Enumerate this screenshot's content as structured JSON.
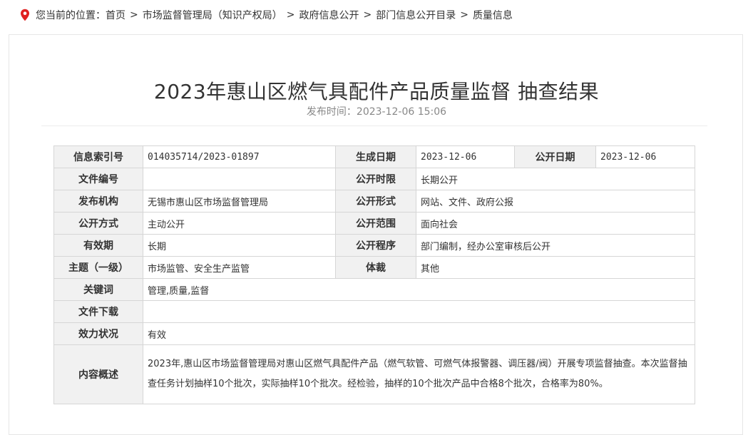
{
  "breadcrumb": {
    "prefix": "您当前的位置：",
    "items": [
      "首页",
      "市场监督管理局（知识产权局）",
      "政府信息公开",
      "部门信息公开目录",
      "质量信息"
    ],
    "separator": ">"
  },
  "article": {
    "title": "2023年惠山区燃气具配件产品质量监督 抽查结果",
    "publish_label": "发布时间：",
    "publish_time": "2023-12-06 15:06"
  },
  "meta": {
    "index_no": {
      "label": "信息索引号",
      "value": "014035714/2023-01897"
    },
    "created_date": {
      "label": "生成日期",
      "value": "2023-12-06"
    },
    "public_date": {
      "label": "公开日期",
      "value": "2023-12-06"
    },
    "doc_no": {
      "label": "文件编号",
      "value": ""
    },
    "public_period": {
      "label": "公开时限",
      "value": "长期公开"
    },
    "issuer": {
      "label": "发布机构",
      "value": "无锡市惠山区市场监督管理局"
    },
    "public_form": {
      "label": "公开形式",
      "value": "网站、文件、政府公报"
    },
    "public_method": {
      "label": "公开方式",
      "value": "主动公开"
    },
    "public_scope": {
      "label": "公开范围",
      "value": "面向社会"
    },
    "validity": {
      "label": "有效期",
      "value": "长期"
    },
    "public_procedure": {
      "label": "公开程序",
      "value": "部门编制，经办公室审核后公开"
    },
    "topic": {
      "label": "主题（一级）",
      "value": "市场监管、安全生产监管"
    },
    "genre": {
      "label": "体裁",
      "value": "其他"
    },
    "keywords": {
      "label": "关键词",
      "value": "管理,质量,监督"
    },
    "download": {
      "label": "文件下载",
      "value": ""
    },
    "effect_status": {
      "label": "效力状况",
      "value": "有效"
    },
    "summary": {
      "label": "内容概述",
      "value": "2023年,惠山区市场监督管理局对惠山区燃气具配件产品（燃气软管、可燃气体报警器、调压器/阀）开展专项监督抽查。本次监督抽查任务计划抽样10个批次，实际抽样10个批次。经检验，抽样的10个批次产品中合格8个批次，合格率为80%。"
    }
  },
  "colors": {
    "accent": "#e02020",
    "label_bg": "#f1f1f1",
    "border": "#d6d6d6"
  },
  "icons": {
    "location": "location-pin-icon"
  }
}
